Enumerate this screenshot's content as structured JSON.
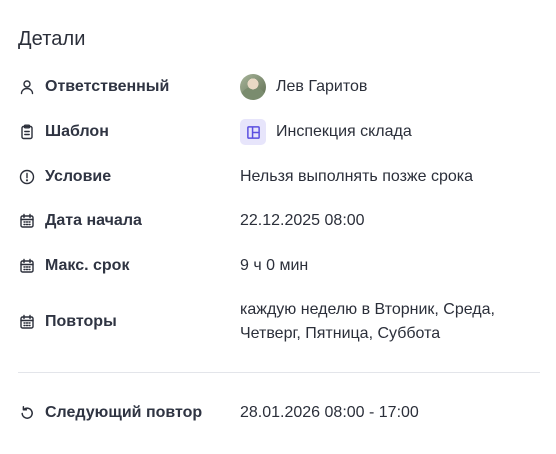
{
  "section": {
    "title": "Детали"
  },
  "rows": [
    {
      "label": "Ответственный",
      "value": "Лев Гаритов",
      "icon": "user-icon"
    },
    {
      "label": "Шаблон",
      "value": "Инспекция склада",
      "icon": "clipboard-icon"
    },
    {
      "label": "Условие",
      "value": "Нельзя выполнять позже срока",
      "icon": "alert-circle-icon"
    },
    {
      "label": "Дата начала",
      "value": "22.12.2025 08:00",
      "icon": "calendar-icon"
    },
    {
      "label": "Макс. срок",
      "value": "9 ч 0 мин",
      "icon": "calendar-icon"
    },
    {
      "label": "Повторы",
      "value_line1": "каждую неделю в Вторник, Среда,",
      "value_line2": "Четверг, Пятница, Суббота",
      "icon": "calendar-icon"
    }
  ],
  "next": {
    "label": "Следующий повтор",
    "value": "28.01.2026 08:00 - 17:00",
    "icon": "refresh-icon"
  },
  "colors": {
    "template_icon_bg": "#e7e5fb",
    "template_icon_fg": "#5b4fe0",
    "divider": "#e3e5ea"
  }
}
